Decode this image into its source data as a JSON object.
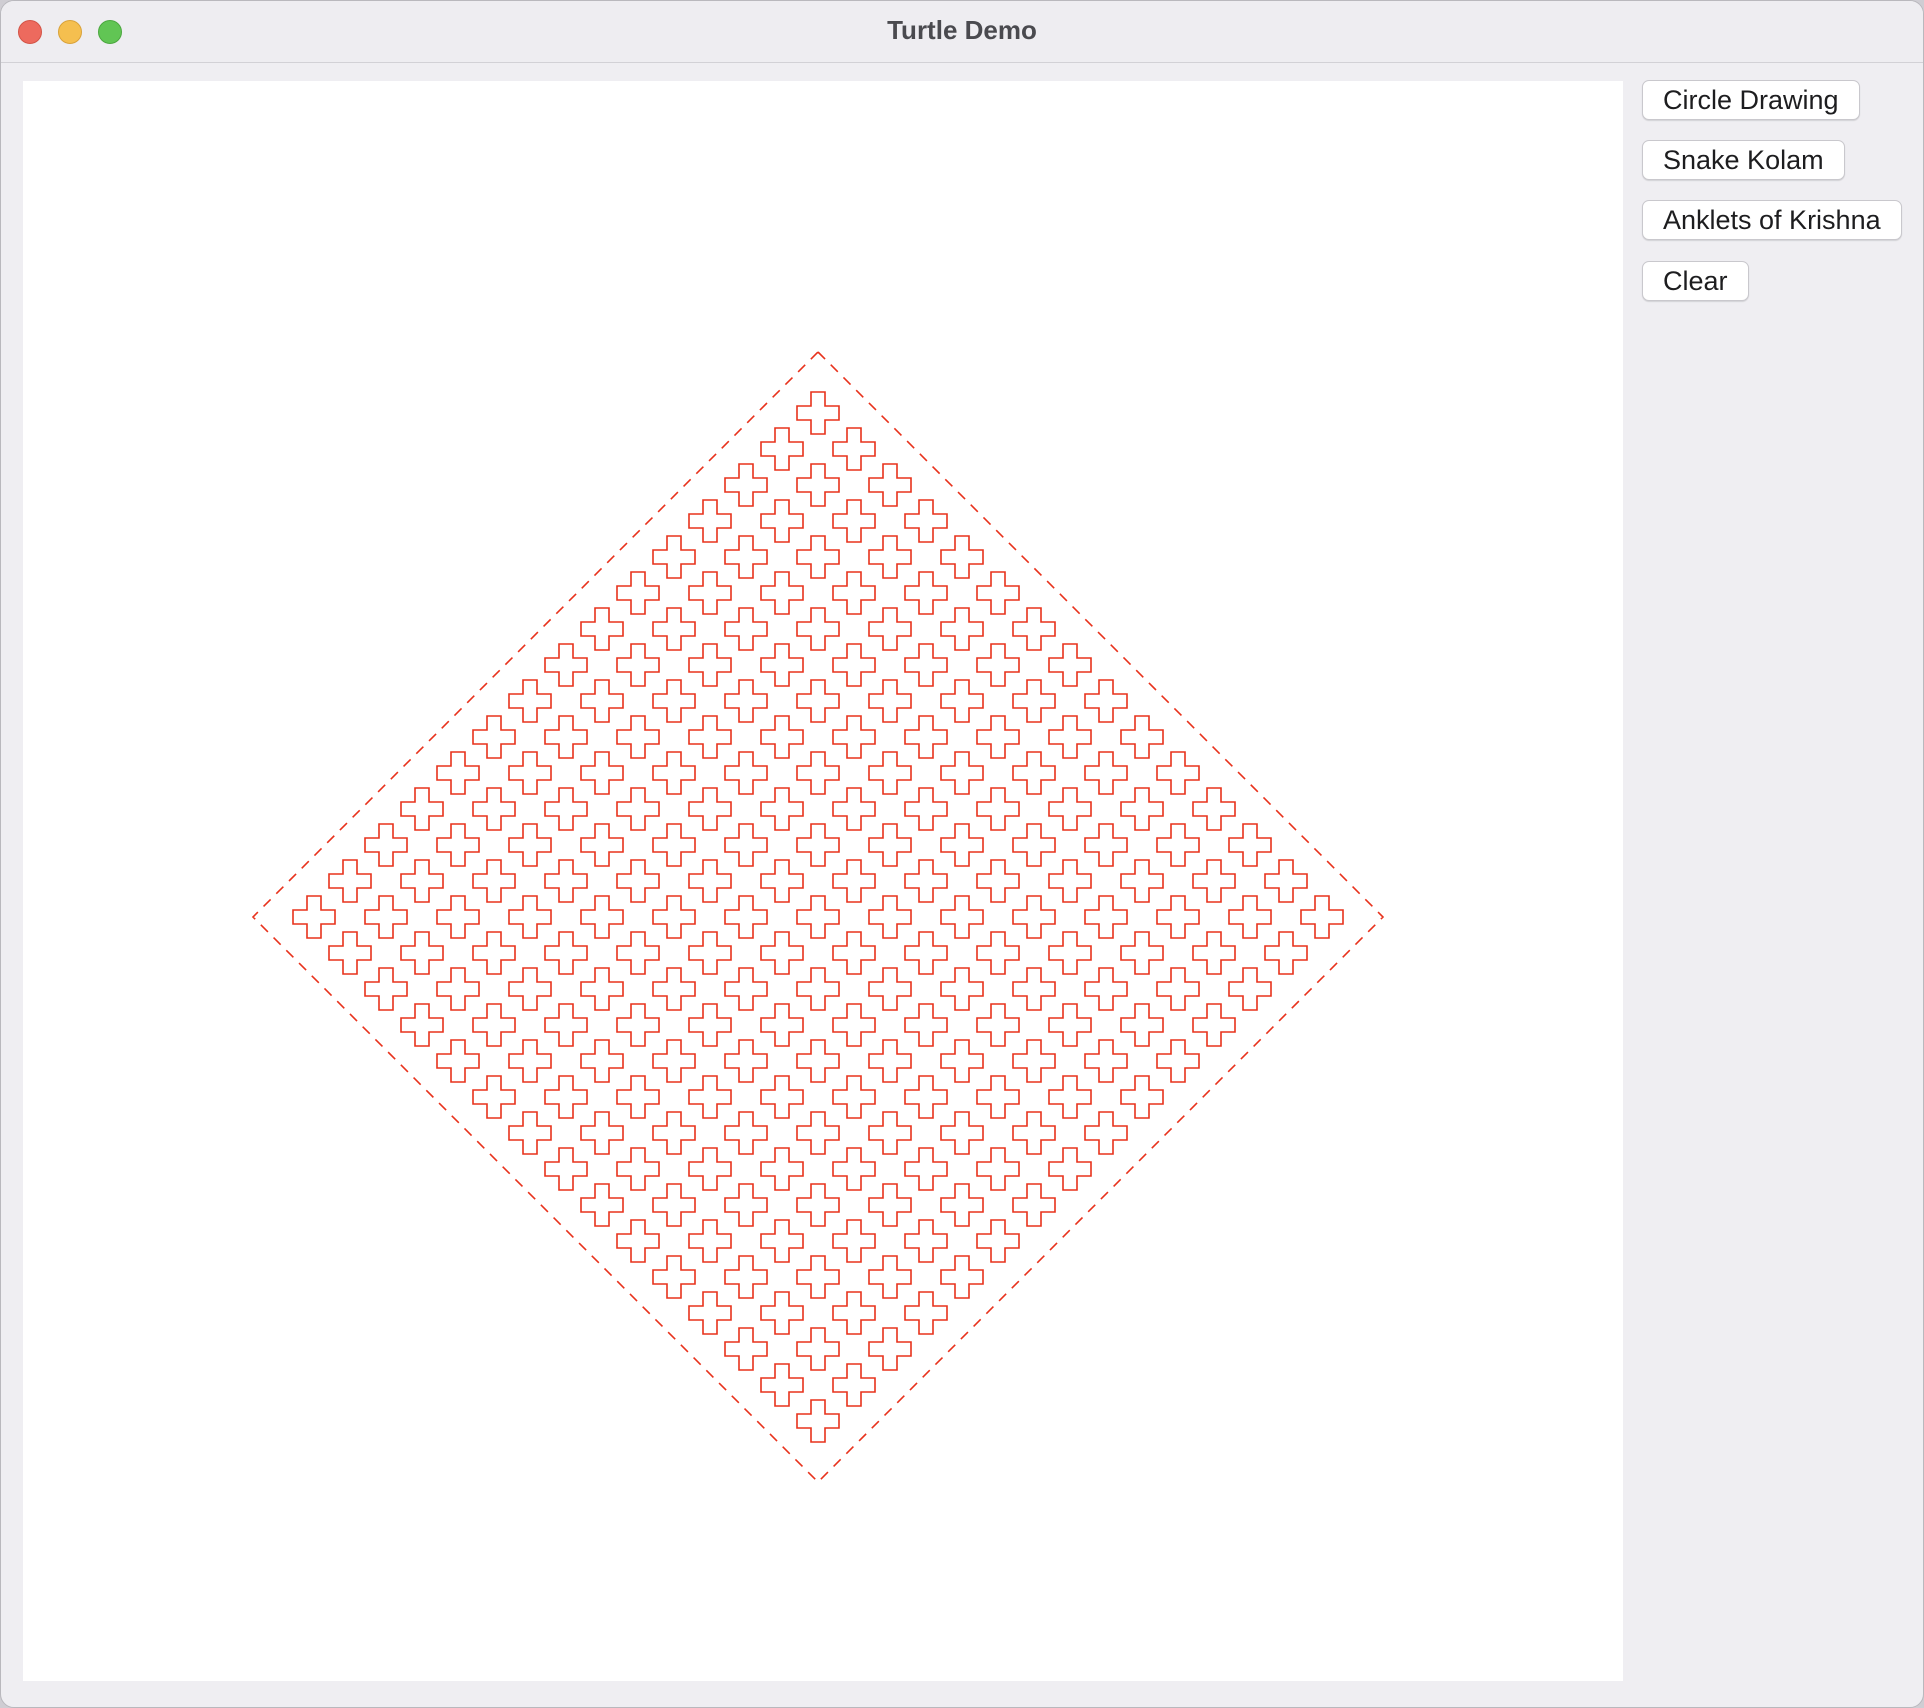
{
  "window": {
    "title": "Turtle Demo"
  },
  "controls": {
    "circle_drawing": "Circle Drawing",
    "snake_kolam": "Snake Kolam",
    "anklets_of_krishna": "Anklets of Krishna",
    "clear": "Clear"
  },
  "drawing": {
    "pattern": "Anklets of Krishna",
    "stroke_color": "#e8321c",
    "background_color": "#ffffff"
  },
  "icons": [
    "close-icon",
    "minimize-icon",
    "zoom-icon"
  ]
}
